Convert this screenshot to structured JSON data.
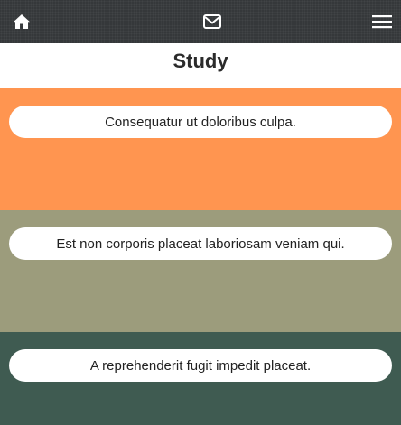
{
  "header": {
    "background": "#35383a",
    "icons": [
      "home-icon",
      "envelope-icon",
      "hamburger-menu-icon"
    ]
  },
  "page": {
    "title": "Study"
  },
  "sections": [
    {
      "text": "Consequatur ut doloribus culpa.",
      "color": "#ff9550"
    },
    {
      "text": "Est non corporis placeat laboriosam veniam qui.",
      "color": "#9c9c7c"
    },
    {
      "text": "A reprehenderit fugit impedit placeat.",
      "color": "#3f5b51"
    }
  ]
}
